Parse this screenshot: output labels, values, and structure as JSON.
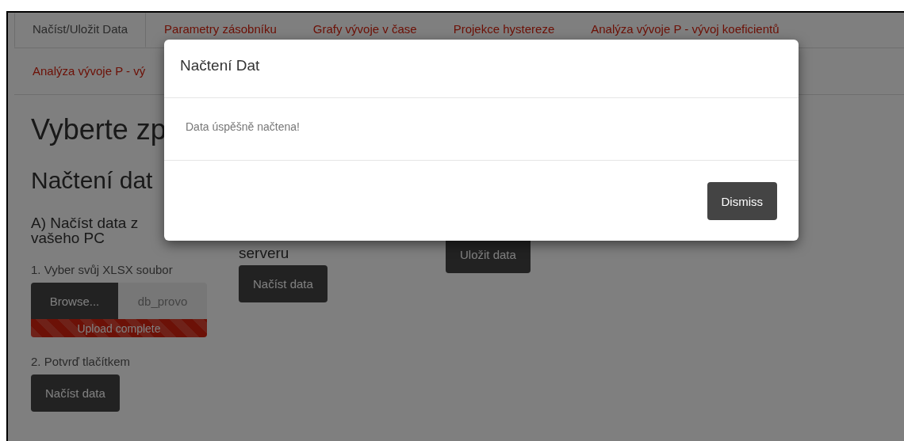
{
  "tabs": [
    {
      "label": "Načíst/Uložit Data",
      "selected": true
    },
    {
      "label": "Parametry zásobníku",
      "selected": false
    },
    {
      "label": "Grafy vývoje v čase",
      "selected": false
    },
    {
      "label": "Projekce hystereze",
      "selected": false
    },
    {
      "label": "Analýza vývoje P - vývoj koeficientů",
      "selected": false
    },
    {
      "label": "Analýza vývoje P - vý",
      "selected": false
    }
  ],
  "page": {
    "title": "Vyberte zp",
    "section": "Načtení dat"
  },
  "columns": [
    {
      "kind": "upload",
      "heading": "A) Načíst data z vašeho PC",
      "step1": "1. Vyber svůj XLSX soubor",
      "browse": "Browse...",
      "file": "db_provo",
      "progress": {
        "label": "Upload complete",
        "level": 1
      },
      "step2": "2. Potvrď tlačítkem",
      "button": "Načíst data"
    },
    {
      "kind": "server",
      "heading": "serveru",
      "button": "Načíst data"
    },
    {
      "kind": "save",
      "button": "Uložit data"
    }
  ],
  "modal": {
    "title": "Načtení Dat",
    "message": "Data úspěšně načtena!",
    "button": "Dismiss"
  }
}
